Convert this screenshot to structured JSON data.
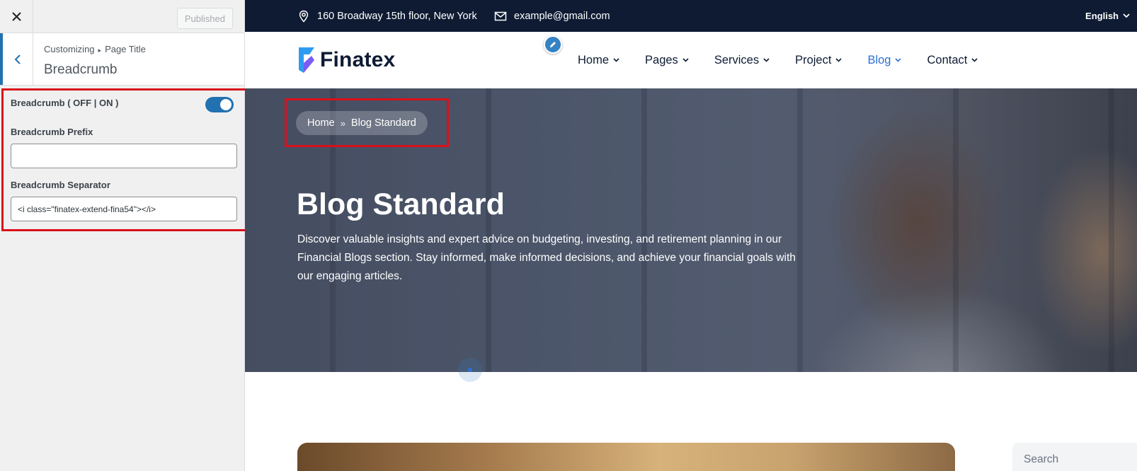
{
  "customizer": {
    "publish_label": "Published",
    "breadcrumb_root": "Customizing",
    "breadcrumb_parent": "Page Title",
    "section_title": "Breadcrumb",
    "controls": {
      "toggle_label": "Breadcrumb ( OFF | ON )",
      "toggle_on": true,
      "prefix_label": "Breadcrumb Prefix",
      "prefix_value": "",
      "separator_label": "Breadcrumb Separator",
      "separator_value": "<i class=\"finatex-extend-fina54\"></i>"
    }
  },
  "site": {
    "topbar": {
      "address": "160 Broadway 15th floor, New York",
      "email": "example@gmail.com",
      "language": "English"
    },
    "logo_text": "Finatex",
    "menu": [
      {
        "label": "Home",
        "active": false
      },
      {
        "label": "Pages",
        "active": false
      },
      {
        "label": "Services",
        "active": false
      },
      {
        "label": "Project",
        "active": false
      },
      {
        "label": "Blog",
        "active": true
      },
      {
        "label": "Contact",
        "active": false
      }
    ],
    "hero": {
      "crumb_home": "Home",
      "crumb_current": "Blog Standard",
      "title": "Blog Standard",
      "description": "Discover valuable insights and expert advice on budgeting, investing, and retirement planning in our Financial Blogs section. Stay informed, make informed decisions, and achieve your financial goals with our engaging articles."
    },
    "sidebar_search_placeholder": "Search"
  },
  "colors": {
    "accent": "#2271b1",
    "highlight": "#d9101a",
    "topbar_bg": "#0e1b33",
    "menu_active": "#2d6fd6"
  }
}
